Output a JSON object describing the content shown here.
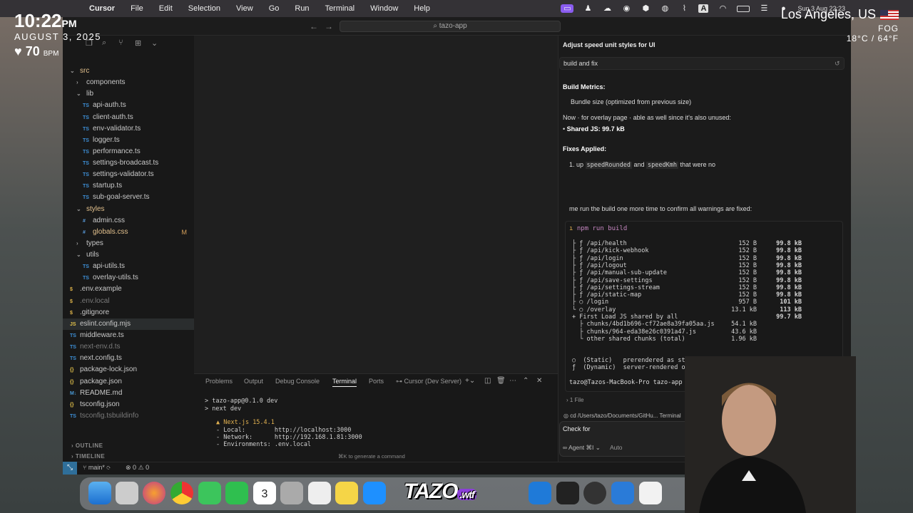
{
  "menubar": {
    "app": "Cursor",
    "items": [
      "File",
      "Edit",
      "Selection",
      "View",
      "Go",
      "Run",
      "Terminal",
      "Window",
      "Help"
    ],
    "date": "Sun 3 Aug 22:23"
  },
  "overlay": {
    "time": "10:22",
    "ampm": "PM",
    "date": "AUGUST 3, 2025",
    "bpm_value": "70",
    "bpm_unit": "BPM",
    "city": "Los Angeles, US",
    "condition": "FOG",
    "temperature": "18°C / 64°F"
  },
  "window": {
    "search": "tazo-app"
  },
  "sidebar": {
    "tree": [
      {
        "label": "src",
        "kind": "folder-open",
        "indent": 0,
        "style": "styles"
      },
      {
        "label": "components",
        "kind": "folder",
        "indent": 1
      },
      {
        "label": "lib",
        "kind": "folder-open",
        "indent": 1
      },
      {
        "label": "api-auth.ts",
        "kind": "ts",
        "indent": 2
      },
      {
        "label": "client-auth.ts",
        "kind": "ts",
        "indent": 2
      },
      {
        "label": "env-validator.ts",
        "kind": "ts",
        "indent": 2
      },
      {
        "label": "logger.ts",
        "kind": "ts",
        "indent": 2
      },
      {
        "label": "performance.ts",
        "kind": "ts",
        "indent": 2
      },
      {
        "label": "settings-broadcast.ts",
        "kind": "ts",
        "indent": 2
      },
      {
        "label": "settings-validator.ts",
        "kind": "ts",
        "indent": 2
      },
      {
        "label": "startup.ts",
        "kind": "ts",
        "indent": 2
      },
      {
        "label": "sub-goal-server.ts",
        "kind": "ts",
        "indent": 2
      },
      {
        "label": "styles",
        "kind": "folder-open",
        "indent": 1,
        "style": "styles"
      },
      {
        "label": "admin.css",
        "kind": "css",
        "indent": 2
      },
      {
        "label": "globals.css",
        "kind": "css",
        "indent": 2,
        "badge": "M",
        "style": "styles"
      },
      {
        "label": "types",
        "kind": "folder",
        "indent": 1
      },
      {
        "label": "utils",
        "kind": "folder-open",
        "indent": 1
      },
      {
        "label": "api-utils.ts",
        "kind": "ts",
        "indent": 2
      },
      {
        "label": "overlay-utils.ts",
        "kind": "ts",
        "indent": 2
      },
      {
        "label": ".env.example",
        "kind": "env",
        "indent": 0
      },
      {
        "label": ".env.local",
        "kind": "env",
        "indent": 0,
        "style": "dim"
      },
      {
        "label": ".gitignore",
        "kind": "env",
        "indent": 0
      },
      {
        "label": "eslint.config.mjs",
        "kind": "js",
        "indent": 0,
        "selected": true
      },
      {
        "label": "middleware.ts",
        "kind": "ts",
        "indent": 0
      },
      {
        "label": "next-env.d.ts",
        "kind": "ts",
        "indent": 0,
        "style": "dim"
      },
      {
        "label": "next.config.ts",
        "kind": "ts",
        "indent": 0
      },
      {
        "label": "package-lock.json",
        "kind": "json",
        "indent": 0
      },
      {
        "label": "package.json",
        "kind": "json",
        "indent": 0
      },
      {
        "label": "README.md",
        "kind": "md",
        "indent": 0
      },
      {
        "label": "tsconfig.json",
        "kind": "json",
        "indent": 0
      },
      {
        "label": "tsconfig.tsbuildinfo",
        "kind": "ts",
        "indent": 0,
        "style": "dim"
      }
    ],
    "outline": "OUTLINE",
    "timeline": "TIMELINE"
  },
  "panel": {
    "tabs": [
      "Problems",
      "Output",
      "Debug Console",
      "Terminal",
      "Ports"
    ],
    "active_tab": "Terminal",
    "terminal_name": "Cursor (Dev Server)",
    "lines": [
      "> tazo-app@0.1.0 dev",
      "> next dev",
      "Next.js 15.4.1",
      "- Local:        http://localhost:3000",
      "- Network:      http://192.168.1.81:3000",
      "- Environments: .env.local"
    ],
    "hint": "⌘K to generate a command"
  },
  "chat": {
    "title": "Adjust speed unit styles for UI",
    "user_message": "build and fix",
    "build_metrics_heading": "Build Metrics:",
    "bundle_line": "Bundle size",
    "bundle_note": "(optimized from previous size)",
    "overlay_page": "for overlay page",
    "now_text": "Now",
    "also_unused": "able as well since it's also unused:",
    "shared_js": "Shared JS: 99.7 kB",
    "fixes_heading": "Fixes Applied:",
    "fix_item": "up",
    "fix_code_1": "speedRounded",
    "fix_and": "and",
    "fix_code_2": "speedKmh",
    "fix_tail": "that were no",
    "rerun_text": "me run the build one more time to confirm all warnings are fixed:",
    "build_command": "npm run build",
    "routes": [
      {
        "path": "├ ƒ /api/health",
        "size": "152 B",
        "first": "99.8 kB"
      },
      {
        "path": "├ ƒ /api/kick-webhook",
        "size": "152 B",
        "first": "99.8 kB"
      },
      {
        "path": "├ ƒ /api/login",
        "size": "152 B",
        "first": "99.8 kB"
      },
      {
        "path": "├ ƒ /api/logout",
        "size": "152 B",
        "first": "99.8 kB"
      },
      {
        "path": "├ ƒ /api/manual-sub-update",
        "size": "152 B",
        "first": "99.8 kB"
      },
      {
        "path": "├ ƒ /api/save-settings",
        "size": "152 B",
        "first": "99.8 kB"
      },
      {
        "path": "├ ƒ /api/settings-stream",
        "size": "152 B",
        "first": "99.8 kB"
      },
      {
        "path": "├ ƒ /api/static-map",
        "size": "152 B",
        "first": "99.8 kB"
      },
      {
        "path": "├ ○ /login",
        "size": "957 B",
        "first": "101 kB"
      },
      {
        "path": "└ ○ /overlay",
        "size": "13.1 kB",
        "first": "113 kB"
      },
      {
        "path": "+ First Load JS shared by all",
        "size": "",
        "first": "99.7 kB"
      },
      {
        "path": "  ├ chunks/4bd1b696-cf72ae8a39fa05aa.js",
        "size": "54.1 kB",
        "first": ""
      },
      {
        "path": "  ├ chunks/964-eda38e26c0391a47.js",
        "size": "43.6 kB",
        "first": ""
      },
      {
        "path": "  └ other shared chunks (total)",
        "size": "1.96 kB",
        "first": ""
      }
    ],
    "legend_static": "○  (Static)   prerendered as static content",
    "legend_dynamic": "ƒ  (Dynamic)  server-rendered on demand",
    "prompt": "tazo@Tazos-MacBook-Pro tazo-app %",
    "files": "1 File",
    "cmd_preview": "cd /Users/tazo/Documents/GitHu...",
    "cmd_preview_label": "Terminal",
    "input_text": "Check for",
    "agent_mode": "Agent ⌘I",
    "auto_mode": "Auto"
  },
  "statusbar": {
    "branch": "main*",
    "problems": "0",
    "warnings": "0"
  },
  "dock": {
    "brand": "TAZO",
    "brand_suffix": ".wtf",
    "calendar_day": "3"
  }
}
